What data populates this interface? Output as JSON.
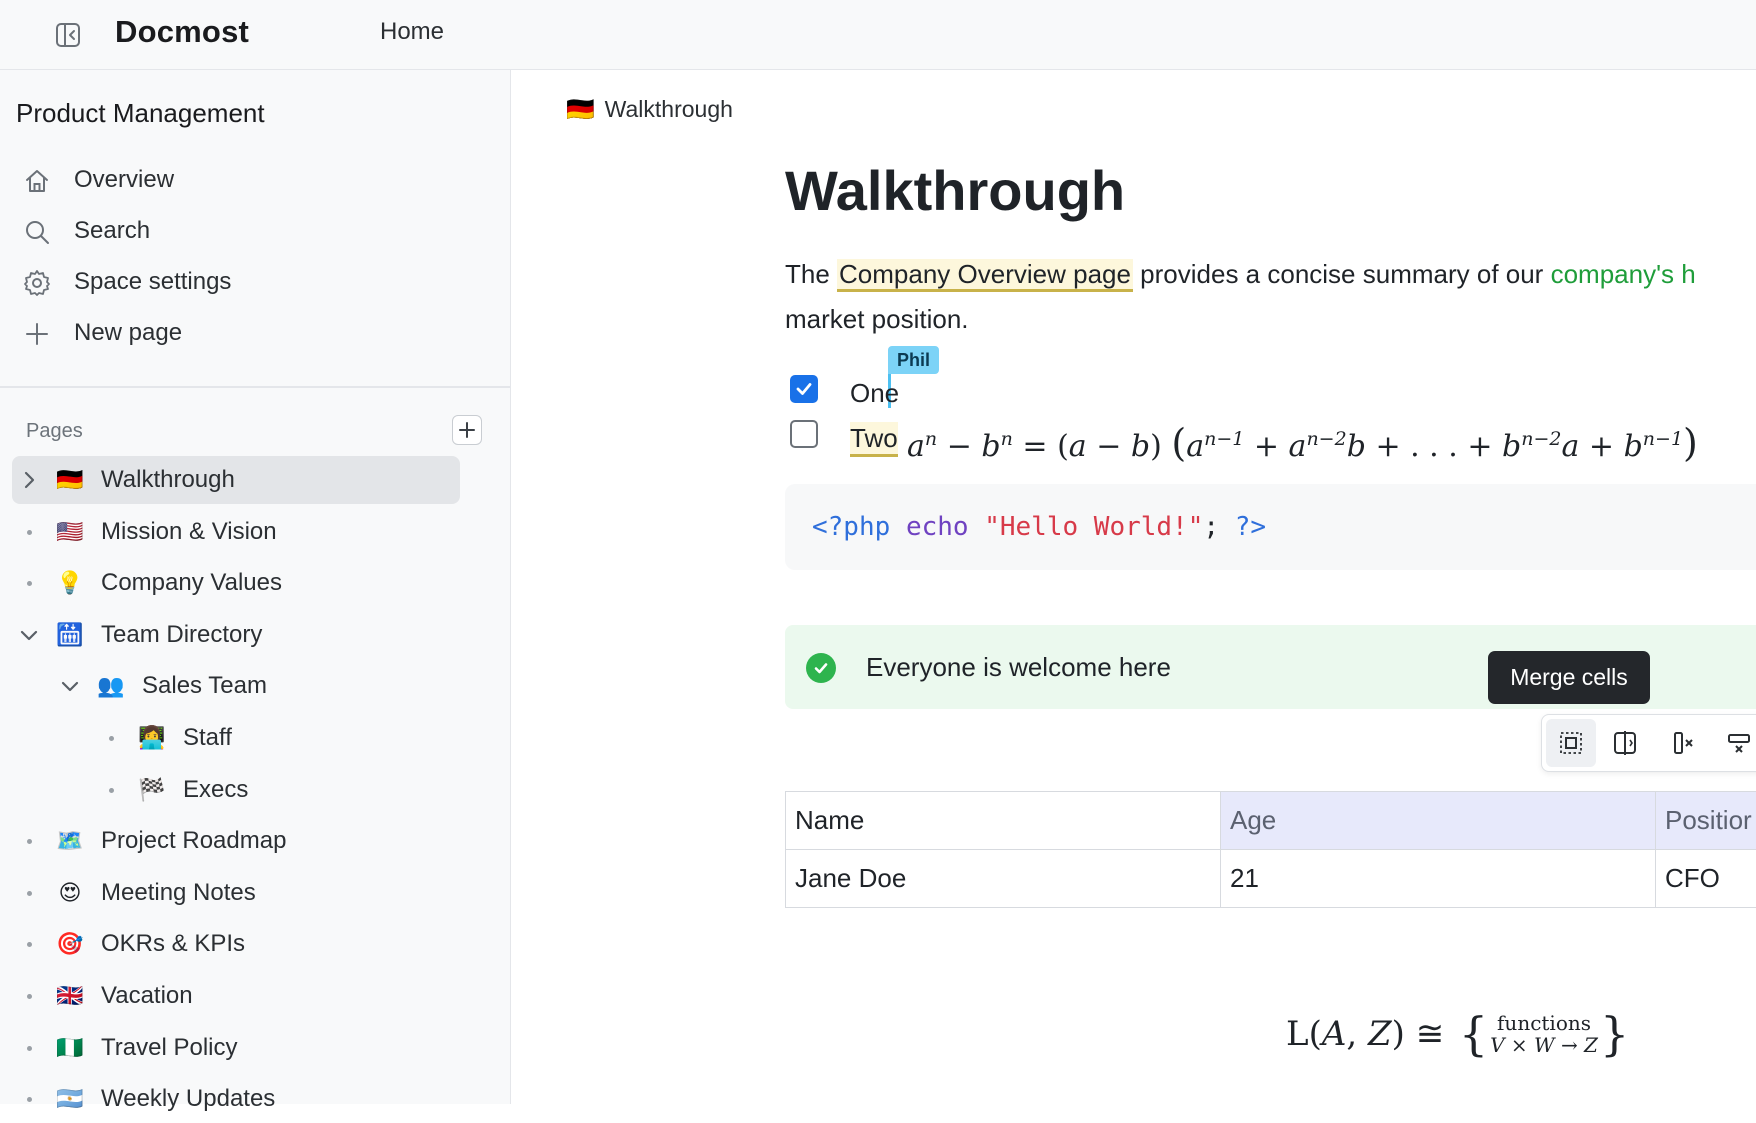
{
  "topbar": {
    "brand": "Docmost",
    "home_label": "Home"
  },
  "sidebar": {
    "space_name": "Product Management",
    "nav": [
      {
        "label": "Overview",
        "icon": "home-icon"
      },
      {
        "label": "Search",
        "icon": "search-icon"
      },
      {
        "label": "Space settings",
        "icon": "gear-icon"
      },
      {
        "label": "New page",
        "icon": "plus-icon"
      }
    ],
    "pages_header": "Pages",
    "pages": [
      {
        "label": "Walkthrough",
        "emoji": "🇩🇪",
        "depth": 0,
        "toggle": "collapsed",
        "active": true
      },
      {
        "label": "Mission & Vision",
        "emoji": "🇺🇸",
        "depth": 0,
        "toggle": "none"
      },
      {
        "label": "Company Values",
        "emoji": "💡",
        "depth": 0,
        "toggle": "none"
      },
      {
        "label": "Team Directory",
        "emoji": "🛗",
        "depth": 0,
        "toggle": "expanded"
      },
      {
        "label": "Sales Team",
        "emoji": "👥",
        "depth": 1,
        "toggle": "expanded"
      },
      {
        "label": "Staff",
        "emoji": "👩‍💻",
        "depth": 2,
        "toggle": "none"
      },
      {
        "label": "Execs",
        "emoji": "🏁",
        "depth": 2,
        "toggle": "none"
      },
      {
        "label": "Project Roadmap",
        "emoji": "🗺️",
        "depth": 0,
        "toggle": "none"
      },
      {
        "label": "Meeting Notes",
        "emoji": "😍",
        "depth": 0,
        "toggle": "none"
      },
      {
        "label": "OKRs & KPIs",
        "emoji": "🎯",
        "depth": 0,
        "toggle": "none"
      },
      {
        "label": "Vacation",
        "emoji": "🇬🇧",
        "depth": 0,
        "toggle": "none"
      },
      {
        "label": "Travel Policy",
        "emoji": "🇳🇬",
        "depth": 0,
        "toggle": "none"
      },
      {
        "label": "Weekly Updates",
        "emoji": "🇦🇷",
        "depth": 0,
        "toggle": "none"
      }
    ]
  },
  "main": {
    "breadcrumb": {
      "emoji": "🇩🇪",
      "label": "Walkthrough"
    },
    "title": "Walkthrough",
    "paragraph": {
      "prefix": "The ",
      "link": "Company Overview page",
      "middle": " provides a concise summary of our ",
      "green": "company's h",
      "line2": "market position."
    },
    "collab_cursor": "Phil",
    "tasks": [
      {
        "label": "One",
        "checked": true
      },
      {
        "label": "Two",
        "checked": false
      }
    ],
    "code": {
      "open": "<?php",
      "fn": "echo",
      "str": "\"Hello World!\"",
      "semi": ";",
      "close": "?>"
    },
    "callout": "Everyone is welcome here",
    "tooltip": "Merge cells",
    "table": {
      "headers": [
        "Name",
        "Age",
        "Positior"
      ],
      "rows": [
        [
          "Jane Doe",
          "21",
          "CFO"
        ]
      ]
    },
    "math_block": {
      "lhs": "L(A, Z) ≅",
      "frac_num": "functions",
      "frac_den": "V × W → Z"
    },
    "colors": {
      "accent": "#1971e8",
      "green_text": "#1f9d3a",
      "callout_bg": "#ebf9ee",
      "cursor_tag": "#7cd3f7"
    }
  }
}
